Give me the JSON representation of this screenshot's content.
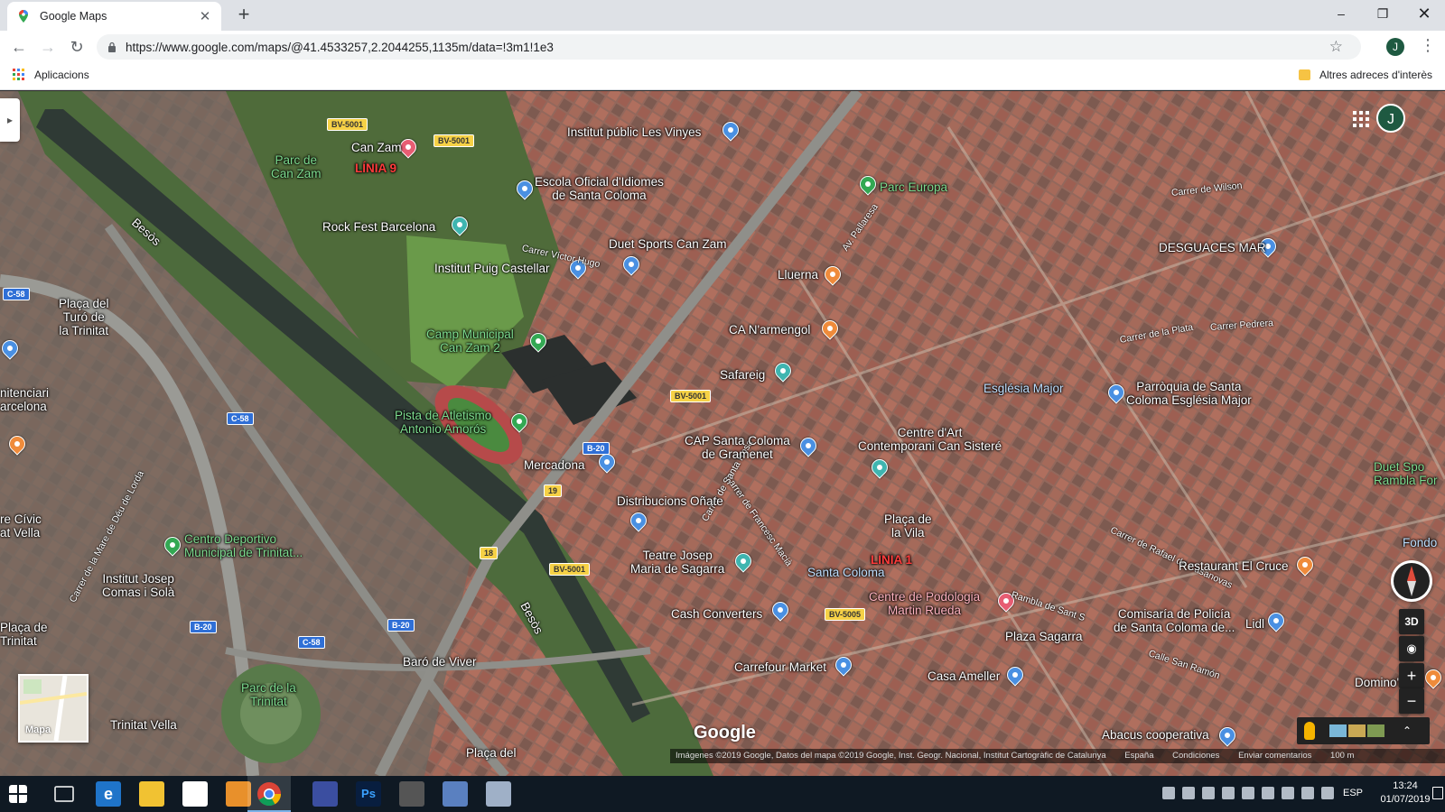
{
  "browser": {
    "tab_title": "Google Maps",
    "tab_close": "✕",
    "new_tab": "+",
    "url": "https://www.google.com/maps/@41.4533257,2.2044255,1135m/data=!3m1!1e3",
    "profile_initial": "J",
    "bookmarks": {
      "apps_label": "Aplicacions",
      "other_label": "Altres adreces d'interès"
    },
    "window_controls": {
      "minimize": "–",
      "maximize": "❐",
      "close": "✕"
    }
  },
  "map": {
    "view": "satellite",
    "avatar_initial": "J",
    "labels": [
      {
        "id": "parc-can-zam",
        "text": "Parc de\nCan Zam",
        "style": "green"
      },
      {
        "id": "can-zam",
        "text": "Can Zam",
        "style": "white"
      },
      {
        "id": "linia-9",
        "text": "LÍNIA 9",
        "style": "red"
      },
      {
        "id": "institut-les-vinyes",
        "text": "Institut públic Les Vinyes",
        "style": "white"
      },
      {
        "id": "escola-idiomes",
        "text": "Escola Oficial d'Idiomes\nde Santa Coloma",
        "style": "white"
      },
      {
        "id": "parc-europa",
        "text": "Parc Europa",
        "style": "green"
      },
      {
        "id": "rock-fest",
        "text": "Rock Fest Barcelona",
        "style": "white"
      },
      {
        "id": "duet-sports",
        "text": "Duet Sports Can Zam",
        "style": "white"
      },
      {
        "id": "institut-puig",
        "text": "Institut Puig Castellar",
        "style": "white"
      },
      {
        "id": "lluerna",
        "text": "Lluerna",
        "style": "white"
      },
      {
        "id": "desguaces-mar",
        "text": "DESGUACES MAR",
        "style": "white"
      },
      {
        "id": "placa-turo",
        "text": "Plaça del\nTuró de\nla Trinitat",
        "style": "white"
      },
      {
        "id": "camp-municipal",
        "text": "Camp Municipal\nCan Zam 2",
        "style": "green"
      },
      {
        "id": "ca-namengol",
        "text": "CA N'armengol",
        "style": "white"
      },
      {
        "id": "safareig",
        "text": "Safareig",
        "style": "white"
      },
      {
        "id": "esglesia-major",
        "text": "Església Major",
        "style": "blue"
      },
      {
        "id": "parroquia",
        "text": "Parròquia de Santa\nColoma Església Major",
        "style": "white"
      },
      {
        "id": "penitenciari",
        "text": "nitenciari\narcelona",
        "style": "white"
      },
      {
        "id": "pista-atletismo",
        "text": "Pista de Atletismo\nAntonio Amorós",
        "style": "green"
      },
      {
        "id": "cap-santa-coloma",
        "text": "CAP Santa Coloma\nde Gramenet",
        "style": "white"
      },
      {
        "id": "centre-art",
        "text": "Centre d'Art\nContemporani Can Sisteré",
        "style": "white"
      },
      {
        "id": "mercadona",
        "text": "Mercadona",
        "style": "white"
      },
      {
        "id": "duet-rambla",
        "text": "Duet Spo\nRambla For",
        "style": "green"
      },
      {
        "id": "distribucions-onate",
        "text": "Distribucions Oñate",
        "style": "white"
      },
      {
        "id": "centre-civic",
        "text": "re Cívic\nat Vella",
        "style": "white"
      },
      {
        "id": "placa-vila",
        "text": "Plaça de\nla Vila",
        "style": "white"
      },
      {
        "id": "centro-deportivo",
        "text": "Centro Deportivo\nMunicipal de Trinitat...",
        "style": "green"
      },
      {
        "id": "fondo",
        "text": "Fondo",
        "style": "blue"
      },
      {
        "id": "teatre-josep",
        "text": "Teatre Josep\nMaria de Sagarra",
        "style": "white"
      },
      {
        "id": "linia-1",
        "text": "LÍNIA 1",
        "style": "red"
      },
      {
        "id": "santa-coloma",
        "text": "Santa Coloma",
        "style": "blue"
      },
      {
        "id": "restaurant-cruce",
        "text": "Restaurant El Cruce",
        "style": "white"
      },
      {
        "id": "institut-josep-comas",
        "text": "Institut Josep\nComas i Solà",
        "style": "white"
      },
      {
        "id": "centre-podologia",
        "text": "Centre de Podologia\nMartin Rueda",
        "style": "pink"
      },
      {
        "id": "cash-converters",
        "text": "Cash Converters",
        "style": "white"
      },
      {
        "id": "comisaria",
        "text": "Comisaría de Policía\nde Santa Coloma de...",
        "style": "white"
      },
      {
        "id": "lidl",
        "text": "Lidl",
        "style": "white"
      },
      {
        "id": "placa-trinitat",
        "text": "Plaça de\nTrinitat",
        "style": "white"
      },
      {
        "id": "plaza-sagarra",
        "text": "Plaza Sagarra",
        "style": "white"
      },
      {
        "id": "baro-viver",
        "text": "Baró de Viver",
        "style": "white"
      },
      {
        "id": "carrefour",
        "text": "Carrefour Market",
        "style": "white"
      },
      {
        "id": "casa-ametller",
        "text": "Casa Ameller",
        "style": "white"
      },
      {
        "id": "parc-trinitat",
        "text": "Parc de la\nTrinitat",
        "style": "green"
      },
      {
        "id": "dominos",
        "text": "Domino's Pi",
        "style": "white"
      },
      {
        "id": "trinitat-vella",
        "text": "Trinitat Vella",
        "style": "white"
      },
      {
        "id": "abacus",
        "text": "Abacus cooperativa",
        "style": "white"
      },
      {
        "id": "placa-del",
        "text": "Plaça del",
        "style": "white"
      },
      {
        "id": "besos-1",
        "text": "Besòs",
        "style": "white"
      },
      {
        "id": "besos-2",
        "text": "Besòs",
        "style": "white"
      }
    ],
    "streets": [
      "Carrer de Wilson",
      "Carrer Pedrera",
      "Carrer de la Plata",
      "Av. Pallaresa",
      "Rambla de Sant S",
      "Calle San Ramón",
      "Carrer de Rafael de Casanovas",
      "Carrer Víctor Hugo",
      "Carrer de Francesc Macià",
      "Carrer de Santa Rosa",
      "Carrer de la Mare de Déu de Lorda"
    ],
    "road_shields": [
      "BV-5001",
      "BV-5001",
      "BV-5001",
      "BV-5001",
      "BV-5005",
      "C-58",
      "C-58",
      "C-58",
      "B-20",
      "B-20",
      "B-20",
      "19",
      "18"
    ],
    "controls": {
      "btn_3d": "3D",
      "zoom_in": "+",
      "zoom_out": "−",
      "layers_label": "Mapa",
      "chevron": "⌃"
    },
    "google_logo": "Google",
    "attribution": [
      "Imágenes ©2019 Google, Datos del mapa ©2019 Google, Inst. Geogr. Nacional, Institut Cartogràfic de Catalunya",
      "España",
      "Condiciones",
      "Enviar comentarios",
      "100 m"
    ]
  },
  "taskbar": {
    "lang": "ESP",
    "time": "13:24",
    "date": "01/07/2019"
  },
  "colors": {
    "accent": "#1a73e8",
    "avatar": "#1e5941",
    "taskbar": "#0f1923"
  }
}
